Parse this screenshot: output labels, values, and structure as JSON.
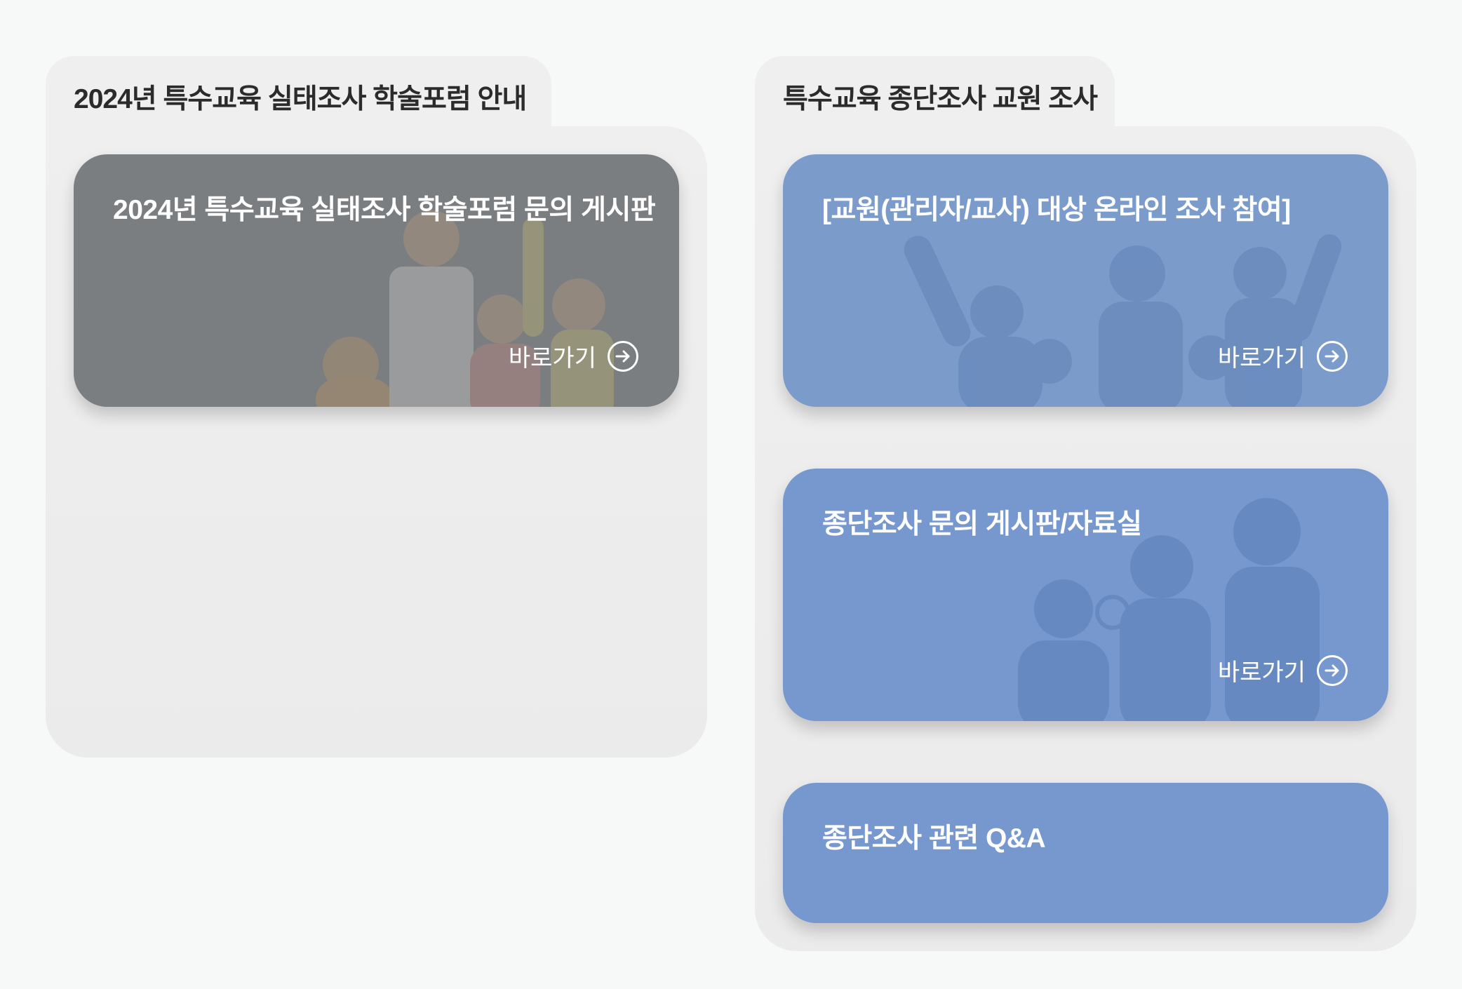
{
  "panels": [
    {
      "title": "2024년 특수교육 실태조사 학술포럼 안내",
      "cards": [
        {
          "title": "2024년 특수교육 실태조사 학술포럼 문의 게시판",
          "link_label": "바로가기"
        }
      ]
    },
    {
      "title": "특수교육 종단조사 교원 조사",
      "cards": [
        {
          "title": "[교원(관리자/교사) 대상 온라인 조사 참여]",
          "link_label": "바로가기"
        },
        {
          "title": "종단조사 문의 게시판/자료실",
          "link_label": "바로가기"
        },
        {
          "title": "종단조사 관련 Q&A"
        }
      ]
    }
  ],
  "colors": {
    "page_background": "#f7f8f8",
    "panel_background": "#efefef",
    "card_gray": "#7b7e81",
    "card_blue": "#7b9ccb",
    "card_blue_alt": "#7698cf",
    "text_dark": "#2b2b2b",
    "text_light": "#ffffff"
  },
  "icons": {
    "link_arrow": "arrow-right-circle-icon"
  }
}
